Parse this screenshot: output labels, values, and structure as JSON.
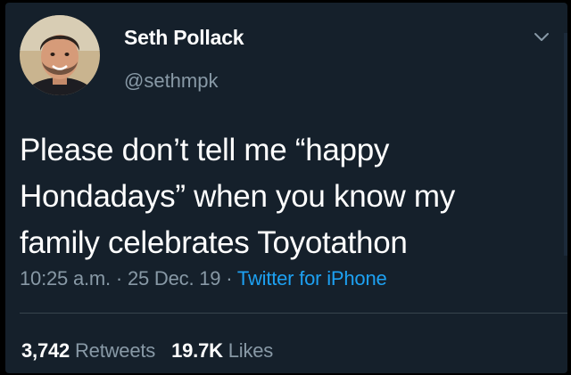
{
  "user": {
    "display_name": "Seth Pollack",
    "handle": "@sethmpk",
    "avatar": "profile-photo"
  },
  "tweet": {
    "lines": [
      "Please don’t tell me “happy",
      "Hondadays” when you know my",
      "family celebrates Toyotathon"
    ]
  },
  "meta": {
    "time": "10:25 a.m.",
    "separator": "·",
    "date": "25 Dec. 19",
    "source": "Twitter for iPhone"
  },
  "stats": {
    "retweets_count": "3,742",
    "retweets_label": "Retweets",
    "likes_count": "19.7K",
    "likes_label": "Likes"
  },
  "icons": {
    "menu": "chevron-down-icon"
  },
  "colors": {
    "background": "#15202b",
    "text": "#ffffff",
    "secondary": "#8899a6",
    "link": "#1da1f2",
    "divider": "#38444d"
  }
}
